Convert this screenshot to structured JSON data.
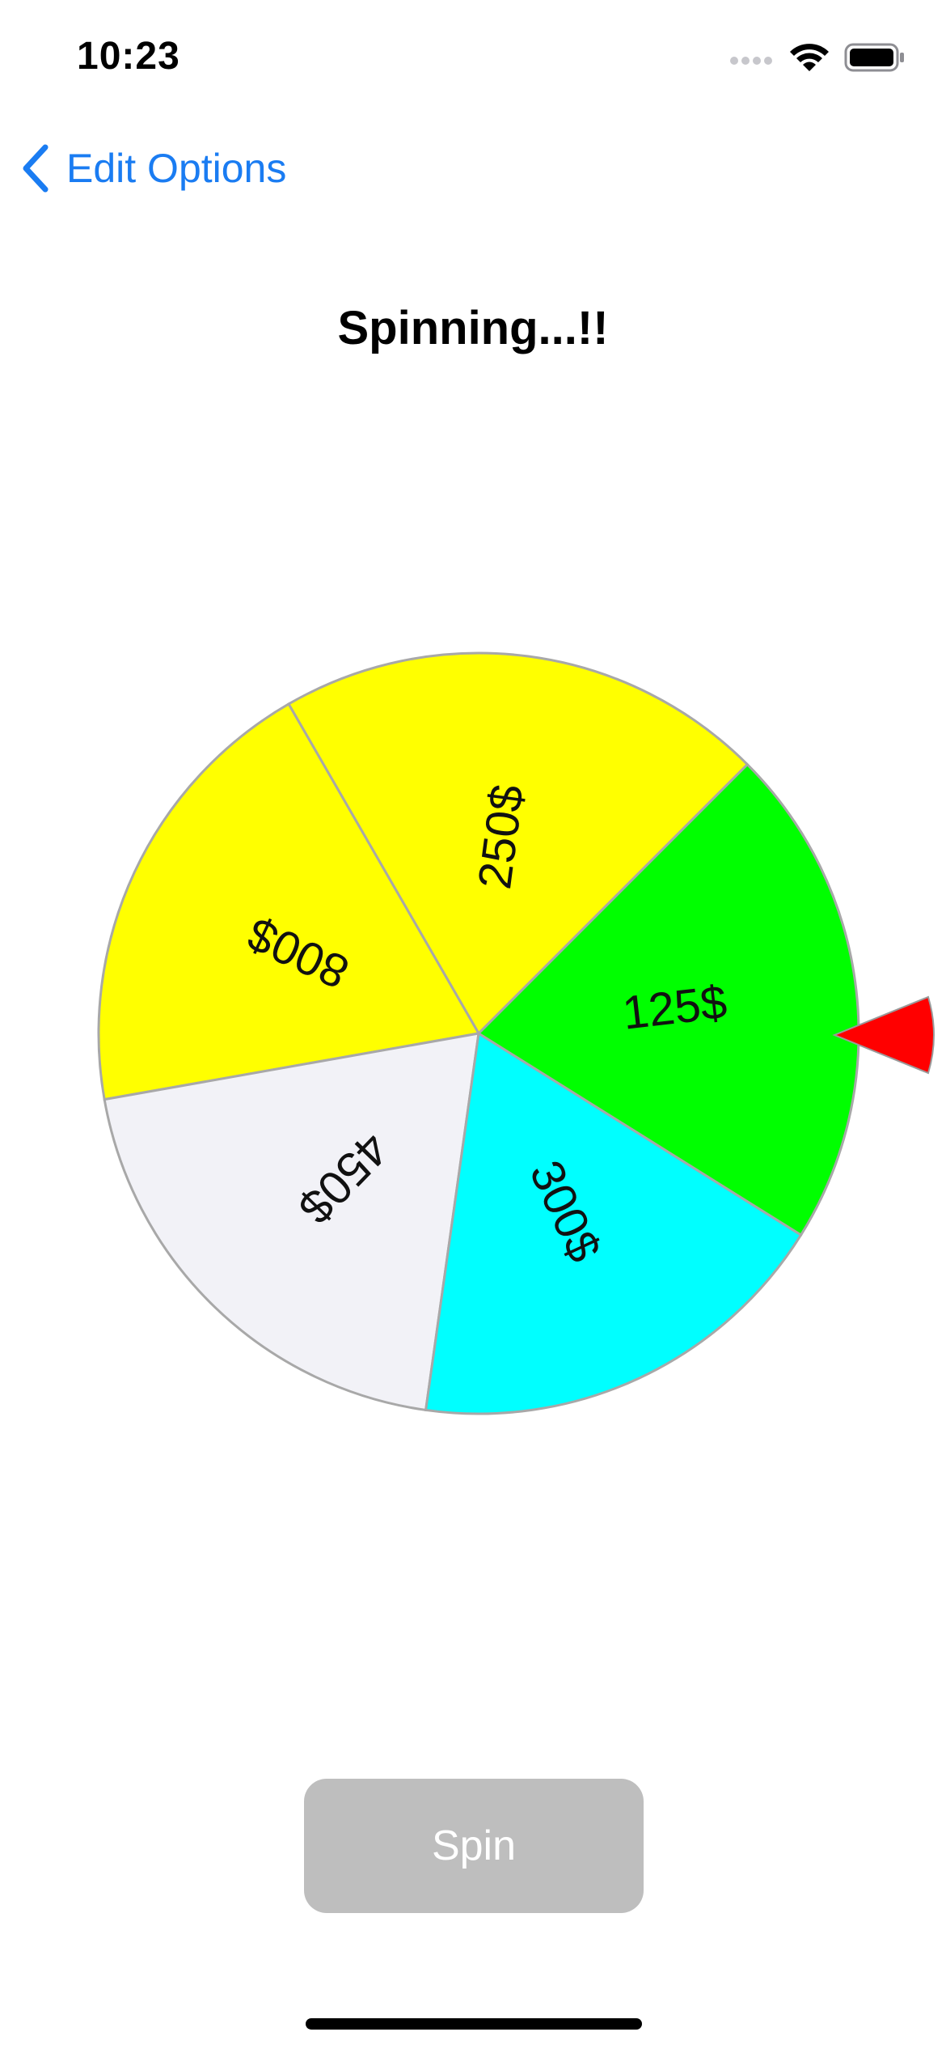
{
  "status_bar": {
    "time": "10:23",
    "icons": [
      "signal-icon",
      "wifi-icon",
      "battery-icon"
    ]
  },
  "nav": {
    "back_label": "Edit Options",
    "back_icon": "chevron-left-icon",
    "accent_color": "#1a7cf2"
  },
  "title": "Spinning...!!",
  "wheel": {
    "segments": [
      {
        "label": "250$",
        "color": "#ffff00"
      },
      {
        "label": "800$",
        "color": "#ffff00"
      },
      {
        "label": "450$",
        "color": "#f2f2f7"
      },
      {
        "label": "300$",
        "color": "#00ffff"
      },
      {
        "label": "125$",
        "color": "#00ff00"
      }
    ],
    "pointer_color": "#ff0000",
    "pointer_icon": "pointer-triangle-icon"
  },
  "spin_button": {
    "label": "Spin",
    "enabled": false,
    "color": "#bebebe"
  }
}
